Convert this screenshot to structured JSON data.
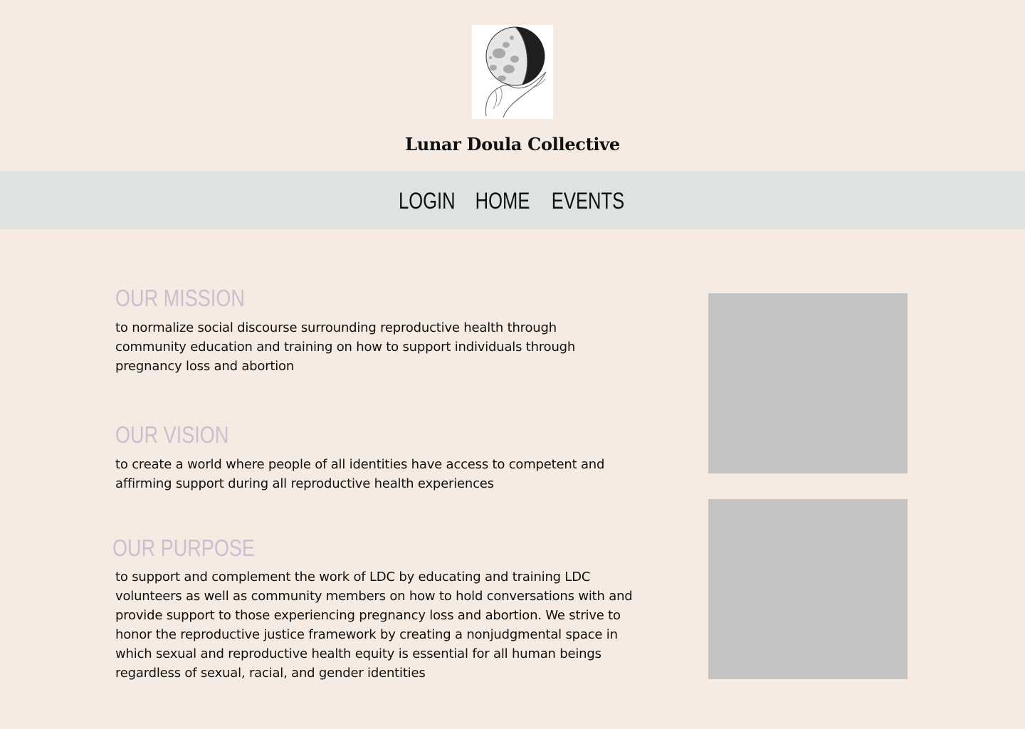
{
  "site": {
    "title": "Lunar Doula Collective",
    "logo_icon": "moon-in-hand-icon"
  },
  "nav": {
    "items": [
      {
        "label": "LOGIN"
      },
      {
        "label": "HOME"
      },
      {
        "label": "EVENTS"
      }
    ]
  },
  "sections": {
    "mission": {
      "heading": "OUR MISSION",
      "body": "to normalize social discourse surrounding reproductive health through community education and training on how to support individuals through pregnancy loss and abortion"
    },
    "vision": {
      "heading": "OUR VISION",
      "body": "to create a world where people of all identities have access to competent and affirming support during all reproductive health experiences"
    },
    "purpose": {
      "heading": "OUR PURPOSE",
      "body": "to support and complement the work of LDC by educating and training LDC volunteers as well as community members on how to hold conversations with and provide support to those experiencing pregnancy loss and abortion. We strive to honor the reproductive justice framework by creating a nonjudgmental space in which sexual and reproductive health equity is essential for all human beings regardless of sexual, racial, and gender identities"
    }
  },
  "colors": {
    "page_background": "#f5ebe2",
    "nav_background": "#dee2e1",
    "heading_color": "#cbbfcf",
    "placeholder_color": "#c4c4c4"
  }
}
